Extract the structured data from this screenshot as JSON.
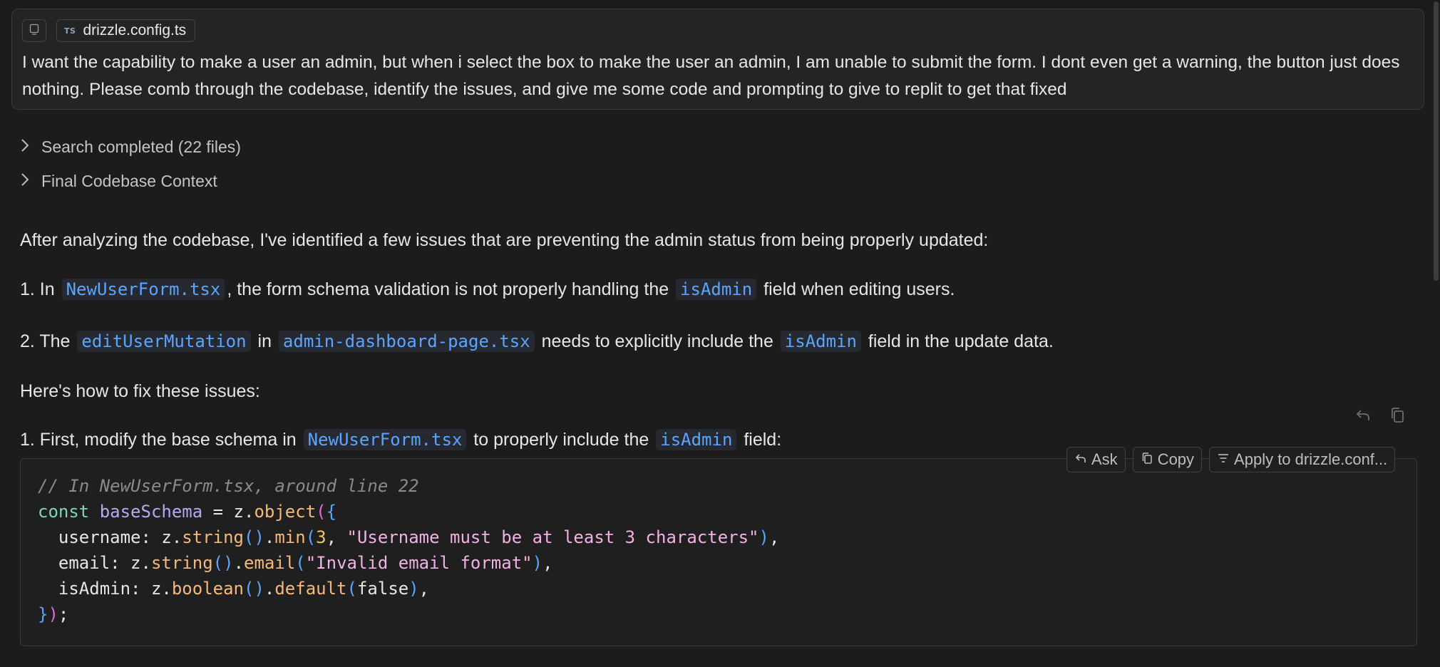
{
  "prompt": {
    "context_chips": [
      {
        "icon": "panel-icon"
      },
      {
        "badge": "TS",
        "name": "drizzle.config.ts"
      }
    ],
    "text": "I want the capability to make a user an admin, but when i select the box to make the user an admin, I am unable to submit the form. I dont even get a warning, the button just does nothing. Please comb through the codebase, identify the issues, and give me some code and prompting to give to replit to get that fixed"
  },
  "collapsibles": [
    {
      "label": "Search completed (22 files)",
      "icon": "chevron-right-icon"
    },
    {
      "label": "Final Codebase Context",
      "icon": "chevron-right-icon"
    }
  ],
  "answer": {
    "intro": "After analyzing the codebase, I've identified a few issues that are preventing the admin status from being properly updated:",
    "issue1": {
      "prefix": "1. In ",
      "file": "NewUserForm.tsx",
      "middle": ", the form schema validation is not properly handling the ",
      "field": "isAdmin",
      "suffix": " field when editing users."
    },
    "issue2": {
      "prefix": "2. The ",
      "mutation": "editUserMutation",
      "in": " in ",
      "file": "admin-dashboard-page.tsx",
      "middle": " needs to explicitly include the ",
      "field": "isAdmin",
      "suffix": " field in the update data."
    },
    "fix_intro": "Here's how to fix these issues:",
    "step1": {
      "prefix": "1. First, modify the base schema in ",
      "file": "NewUserForm.tsx",
      "middle": " to properly include the ",
      "field": "isAdmin",
      "suffix": " field:"
    }
  },
  "message_actions": [
    {
      "icon": "reply-icon"
    },
    {
      "icon": "copy-icon"
    }
  ],
  "code_block": {
    "toolbar": {
      "ask_label": "Ask",
      "copy_label": "Copy",
      "apply_label": "Apply to drizzle.conf..."
    },
    "lines": {
      "l1_comment": "// In NewUserForm.tsx, around line 22",
      "l2_const": "const",
      "l2_name": "baseSchema",
      "l2_eq": " = z.",
      "l2_fn": "object",
      "l3_key": "  username: z.",
      "l3_fn1": "string",
      "l3_fn2": "min",
      "l3_num": "3",
      "l3_str": "\"Username must be at least 3 characters\"",
      "l4_key": "  email: z.",
      "l4_fn1": "string",
      "l4_fn2": "email",
      "l4_str": "\"Invalid email format\"",
      "l5_key": "  isAdmin: z.",
      "l5_fn1": "boolean",
      "l5_fn2": "default",
      "l5_val": "false"
    }
  },
  "colors": {
    "background": "#1c1c1c",
    "inline_code": "#5aa5ff",
    "card_border": "#3a3a3a"
  }
}
